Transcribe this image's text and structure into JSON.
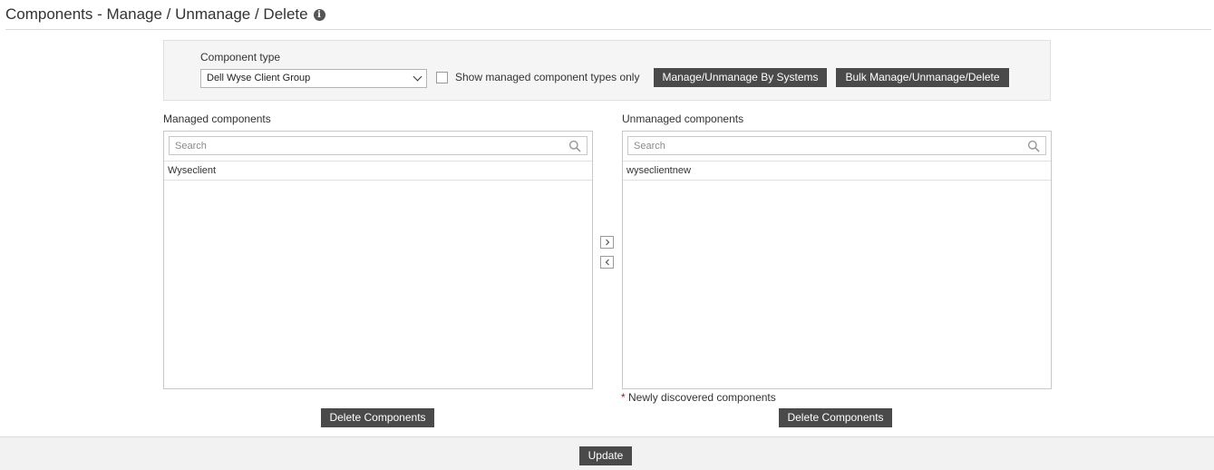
{
  "page": {
    "title": "Components - Manage / Unmanage / Delete",
    "info_icon": "info-circle-icon"
  },
  "filter": {
    "component_type_label": "Component type",
    "component_type_value": "Dell Wyse Client Group",
    "show_managed_only_label": "Show managed component types only",
    "show_managed_only_checked": false,
    "manage_by_systems_label": "Manage/Unmanage By Systems",
    "bulk_manage_label": "Bulk Manage/Unmanage/Delete"
  },
  "managed": {
    "label": "Managed components",
    "search_placeholder": "Search",
    "items": [
      "Wyseclient"
    ],
    "delete_label": "Delete Components"
  },
  "unmanaged": {
    "label": "Unmanaged components",
    "search_placeholder": "Search",
    "items": [
      "wyseclientnew"
    ],
    "note_marker": "*",
    "note_text": "Newly discovered components",
    "delete_label": "Delete Components"
  },
  "transfer": {
    "move_right_icon": "chevron-right-icon",
    "move_left_icon": "chevron-left-icon"
  },
  "footer": {
    "update_label": "Update"
  },
  "colors": {
    "button_bg": "#4a4a4a",
    "panel_bg": "#f5f5f5",
    "required_star": "#d00000"
  }
}
